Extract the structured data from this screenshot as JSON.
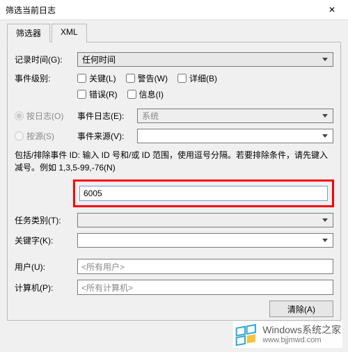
{
  "window": {
    "title": "筛选当前日志"
  },
  "tabs": {
    "filter": "筛选器",
    "xml": "XML"
  },
  "labels": {
    "logged": "记录时间(G):",
    "level": "事件级别:",
    "by_log": "按日志(O)",
    "by_source": "按源(S)",
    "event_log": "事件日志(E):",
    "event_sources": "事件来源(V):",
    "help": "包括/排除事件 ID: 输入 ID 号和/或 ID 范围，使用逗号分隔。若要排除条件，请先键入减号。例如 1,3,5-99,-76(N)",
    "task_category": "任务类别(T):",
    "keywords": "关键字(K):",
    "user": "用户(U):",
    "computer": "计算机(P):",
    "clear": "清除(A)"
  },
  "values": {
    "logged_any": "任何时间",
    "event_log_system": "系统",
    "event_sources": "",
    "event_id": "6005",
    "task_category": "",
    "keywords": "",
    "user_placeholder": "<所有用户>",
    "computer_placeholder": "<所有计算机>"
  },
  "checkboxes": {
    "critical": {
      "label": "关键(L)",
      "checked": false
    },
    "warning": {
      "label": "警告(W)",
      "checked": false
    },
    "verbose": {
      "label": "详细(B)",
      "checked": false
    },
    "error": {
      "label": "错误(R)",
      "checked": false
    },
    "info": {
      "label": "信息(I)",
      "checked": false
    }
  },
  "radios": {
    "by_log": {
      "checked": true,
      "disabled": true
    },
    "by_source": {
      "checked": false,
      "disabled": true
    }
  },
  "watermark": {
    "brand": "Windows",
    "sub1": "系统之家",
    "url": "www.bjjmwd.com"
  }
}
